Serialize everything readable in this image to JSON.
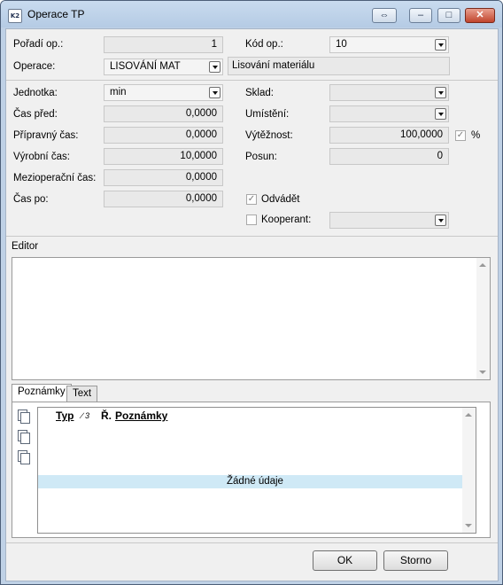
{
  "window": {
    "title": "Operace TP",
    "app_icon": "K2",
    "restore_label": "⇔",
    "minimize_label": "–",
    "maximize_label": "□",
    "close_label": "✕"
  },
  "fields": {
    "poradi_label": "Pořadí op.:",
    "poradi_value": "1",
    "kod_label": "Kód op.:",
    "kod_value": "10",
    "operace_label": "Operace:",
    "operace_value": "LISOVÁNÍ MAT",
    "operace_desc": "Lisování materiálu",
    "jednotka_label": "Jednotka:",
    "jednotka_value": "min",
    "sklad_label": "Sklad:",
    "sklad_value": "",
    "cas_pred_label": "Čas před:",
    "cas_pred_value": "0,0000",
    "umisteni_label": "Umístění:",
    "umisteni_value": "",
    "pripravny_label": "Přípravný čas:",
    "pripravny_value": "0,0000",
    "vytéznost_label": "Výtěžnost:",
    "vytéznost_value": "100,0000",
    "percent_label": "%",
    "vyrobni_label": "Výrobní čas:",
    "vyrobni_value": "10,0000",
    "posun_label": "Posun:",
    "posun_value": "0",
    "mezi_label": "Mezioperační čas:",
    "mezi_value": "0,0000",
    "cas_po_label": "Čas po:",
    "cas_po_value": "0,0000",
    "odvadet_label": "Odvádět",
    "odvadet_checked": true,
    "kooperant_label": "Kooperant:",
    "kooperant_checked": false,
    "kooperant_value": ""
  },
  "editor": {
    "label": "Editor",
    "content": ""
  },
  "tabs": [
    {
      "label": "Poznámky",
      "active": true
    },
    {
      "label": "Text",
      "active": false
    }
  ],
  "notes_grid": {
    "columns": [
      "Typ",
      "∕ 3",
      "Ř.",
      "Poznámky"
    ],
    "empty_text": "Žádné údaje",
    "highlight_color": "#cfe9f6"
  },
  "side_icons": [
    "new-note-icon",
    "edit-note-icon",
    "copy-note-icon"
  ],
  "buttons": {
    "ok": "OK",
    "cancel": "Storno"
  }
}
